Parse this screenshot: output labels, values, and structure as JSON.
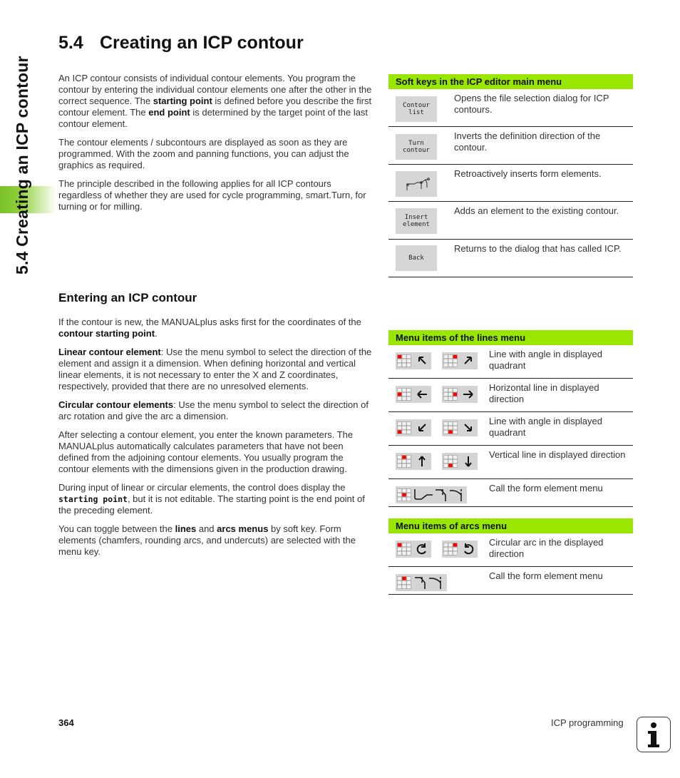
{
  "sidebar": {
    "chapter_tab": "5.4 Creating an ICP contour"
  },
  "page": {
    "section_number": "5.4",
    "title": "Creating an ICP contour"
  },
  "intro": {
    "p1": [
      "An ICP contour consists of individual contour elements. You program the contour by entering the individual contour elements one after the other in the correct sequence. The ",
      "starting point",
      " is defined before you describe the first contour element. The ",
      "end point",
      " is determined by the target point of the last contour element."
    ],
    "p2": "The contour elements / subcontours are displayed as soon as they are programmed. With the zoom and panning functions, you can adjust the graphics as required.",
    "p3": "The principle described in the following applies for all ICP contours regardless of whether they are used for cycle programming, smart.Turn, for turning or for milling."
  },
  "entering": {
    "heading": "Entering an ICP contour",
    "p1": [
      "If the contour is new, the MANUALplus asks first for the coordinates of the ",
      "contour starting point",
      "."
    ],
    "p2": [
      "Linear contour element",
      ": Use the menu symbol to select the direction of the element and assign it a dimension. When defining horizontal and vertical linear elements, it is not necessary to enter the X and Z coordinates, respectively, provided that there are no unresolved elements."
    ],
    "p3": [
      "Circular contour elements",
      ": Use the menu symbol to select the direction of arc rotation and give the arc a dimension."
    ],
    "p4": "After selecting a contour element, you enter the known parameters. The MANUALplus automatically calculates parameters that have not been defined from the adjoining contour elements. You usually program the contour elements with the dimensions given in the production drawing.",
    "p5": [
      "During input of linear or circular elements, the control does display the ",
      "starting point",
      ", but it is not editable. The starting point is the end point of the preceding element."
    ],
    "p6": [
      "You can toggle between the ",
      "lines",
      " and ",
      "arcs menus",
      " by soft key. Form elements (chamfers, rounding arcs, and undercuts) are selected with the menu key."
    ]
  },
  "softkeys_table": {
    "header": "Soft keys in the ICP editor main menu",
    "rows": [
      {
        "key": "Contour\nlist",
        "desc": "Opens the file selection dialog for ICP contours."
      },
      {
        "key": "Turn\ncontour",
        "desc": "Inverts the definition direction of the contour."
      },
      {
        "key": "form-elements-icon",
        "desc": "Retroactively inserts form elements."
      },
      {
        "key": "Insert\nelement",
        "desc": "Adds an element to the existing contour."
      },
      {
        "key": "Back",
        "desc": "Returns to the dialog that has called ICP."
      }
    ]
  },
  "lines_table": {
    "header": "Menu items of the lines menu",
    "rows": [
      {
        "icons": [
          "arrow-up-left-icon",
          "arrow-up-right-icon"
        ],
        "desc": "Line with angle in displayed quadrant"
      },
      {
        "icons": [
          "arrow-left-icon",
          "arrow-right-icon"
        ],
        "desc": "Horizontal line in displayed direction"
      },
      {
        "icons": [
          "arrow-down-left-icon",
          "arrow-down-right-icon"
        ],
        "desc": "Line with angle in displayed quadrant"
      },
      {
        "icons": [
          "arrow-up-icon",
          "arrow-down-icon"
        ],
        "desc": "Vertical line in displayed direction"
      },
      {
        "icons": [
          "form-element-menu-icon"
        ],
        "desc": "Call the form element menu"
      }
    ]
  },
  "arcs_table": {
    "header": "Menu items of arcs menu",
    "rows": [
      {
        "icons": [
          "arc-clockwise-icon",
          "arc-counterclockwise-icon"
        ],
        "desc": "Circular arc in the displayed direction"
      },
      {
        "icons": [
          "form-element-menu-icon"
        ],
        "desc": "Call the form element menu"
      }
    ]
  },
  "footer": {
    "page_number": "364",
    "chapter": "ICP programming",
    "info_icon": "i"
  },
  "colors": {
    "header_green": "#99e600",
    "highlight_red": "#ff0000",
    "softkey_gray": "#d6d6d6"
  }
}
